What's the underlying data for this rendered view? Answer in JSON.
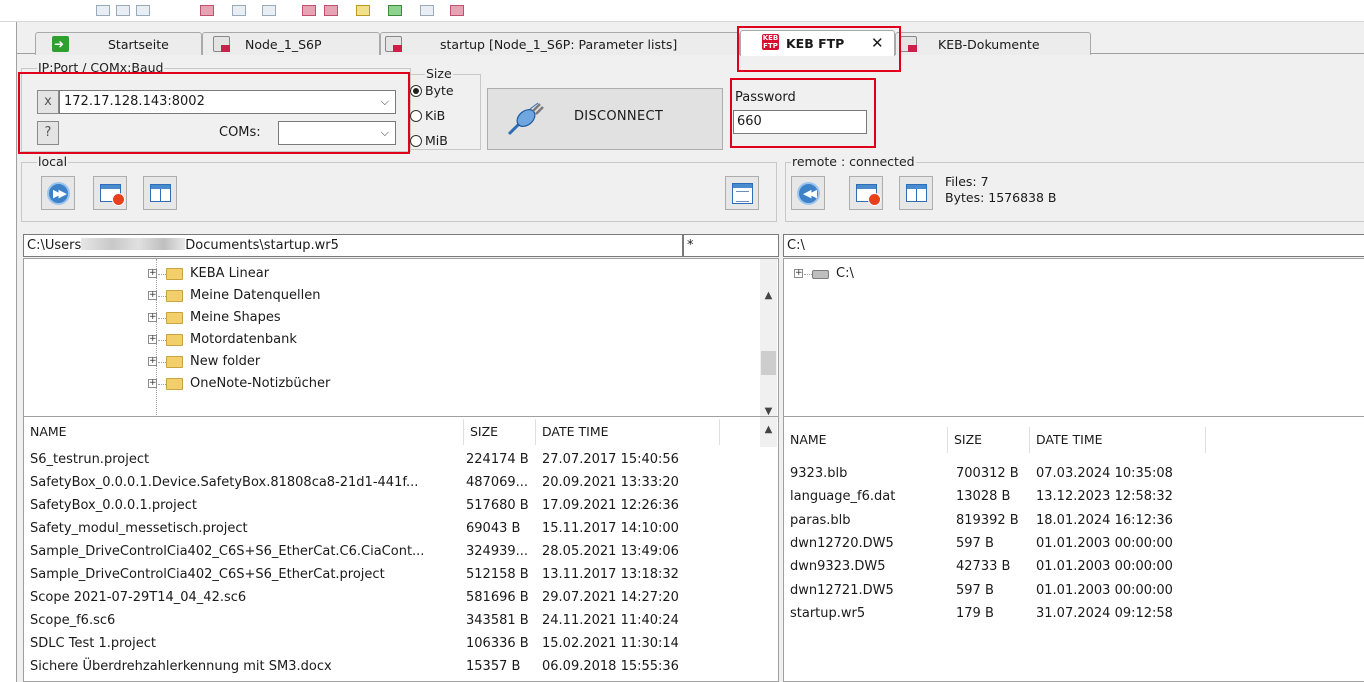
{
  "tabs": [
    {
      "label": "Startseite"
    },
    {
      "label": "Node_1_S6P"
    },
    {
      "label": "startup [Node_1_S6P: Parameter lists]"
    },
    {
      "label": "KEB FTP",
      "active": true
    },
    {
      "label": "KEB-Dokumente"
    }
  ],
  "connection": {
    "group_label": "IP:Port / COMx:Baud",
    "prefix_button": "x",
    "address_value": "172.17.128.143:8002",
    "help_button": "?",
    "coms_label": "COMs:",
    "coms_value": ""
  },
  "size": {
    "group_label": "Size",
    "options": [
      "Byte",
      "KiB",
      "MiB"
    ],
    "selected": "Byte"
  },
  "disconnect_label": "DISCONNECT",
  "password": {
    "label": "Password",
    "value": "660"
  },
  "local": {
    "label": "local",
    "path_prefix": "C:\\Users",
    "path_suffix": "Documents\\startup.wr5",
    "filter": "*",
    "tree": [
      "KEBA Linear",
      "Meine Datenquellen",
      "Meine Shapes",
      "Motordatenbank",
      "New folder",
      "OneNote-Notizbücher"
    ],
    "columns": [
      "NAME",
      "SIZE",
      "DATE TIME"
    ],
    "files": [
      {
        "name": "S6_testrun.project",
        "size": "224174 B",
        "date": "27.07.2017 15:40:56"
      },
      {
        "name": "SafetyBox_0.0.0.1.Device.SafetyBox.81808ca8-21d1-441f...",
        "size": "487069...",
        "date": "20.09.2021 13:33:20"
      },
      {
        "name": "SafetyBox_0.0.0.1.project",
        "size": "517680 B",
        "date": "17.09.2021 12:26:36"
      },
      {
        "name": "Safety_modul_messetisch.project",
        "size": "69043 B",
        "date": "15.11.2017 14:10:00"
      },
      {
        "name": "Sample_DriveControlCia402_C6S+S6_EtherCat.C6.CiaCont...",
        "size": "324939...",
        "date": "28.05.2021 13:49:06"
      },
      {
        "name": "Sample_DriveControlCia402_C6S+S6_EtherCat.project",
        "size": "512158 B",
        "date": "13.11.2017 13:18:32"
      },
      {
        "name": "Scope 2021-07-29T14_04_42.sc6",
        "size": "581696 B",
        "date": "29.07.2021 14:27:20"
      },
      {
        "name": "Scope_f6.sc6",
        "size": "343581 B",
        "date": "24.11.2021 11:40:24"
      },
      {
        "name": "SDLC Test 1.project",
        "size": "106336 B",
        "date": "15.02.2021 11:30:14"
      },
      {
        "name": "Sichere Überdrehzahlerkennung mit SM3.docx",
        "size": "15357 B",
        "date": "06.09.2018 15:55:36"
      }
    ]
  },
  "remote": {
    "label": "remote : connected",
    "files_count": "Files: 7",
    "bytes_total": "Bytes: 1576838 B",
    "path": "C:\\",
    "tree": [
      "C:\\"
    ],
    "columns": [
      "NAME",
      "SIZE",
      "DATE TIME"
    ],
    "files": [
      {
        "name": "9323.blb",
        "size": "700312 B",
        "date": "07.03.2024 10:35:08"
      },
      {
        "name": "language_f6.dat",
        "size": "13028 B",
        "date": "13.12.2023 12:58:32"
      },
      {
        "name": "paras.blb",
        "size": "819392 B",
        "date": "18.01.2024 16:12:36"
      },
      {
        "name": "dwn12720.DW5",
        "size": "597 B",
        "date": "01.01.2003 00:00:00"
      },
      {
        "name": "dwn9323.DW5",
        "size": "42733 B",
        "date": "01.01.2003 00:00:00"
      },
      {
        "name": "dwn12721.DW5",
        "size": "597 B",
        "date": "01.01.2003 00:00:00"
      },
      {
        "name": "startup.wr5",
        "size": "179 B",
        "date": "31.07.2024 09:12:58"
      }
    ]
  },
  "colors": {
    "highlight": "#e0001b",
    "window_bg": "#f0f0f0",
    "keb_red": "#d6102e"
  }
}
